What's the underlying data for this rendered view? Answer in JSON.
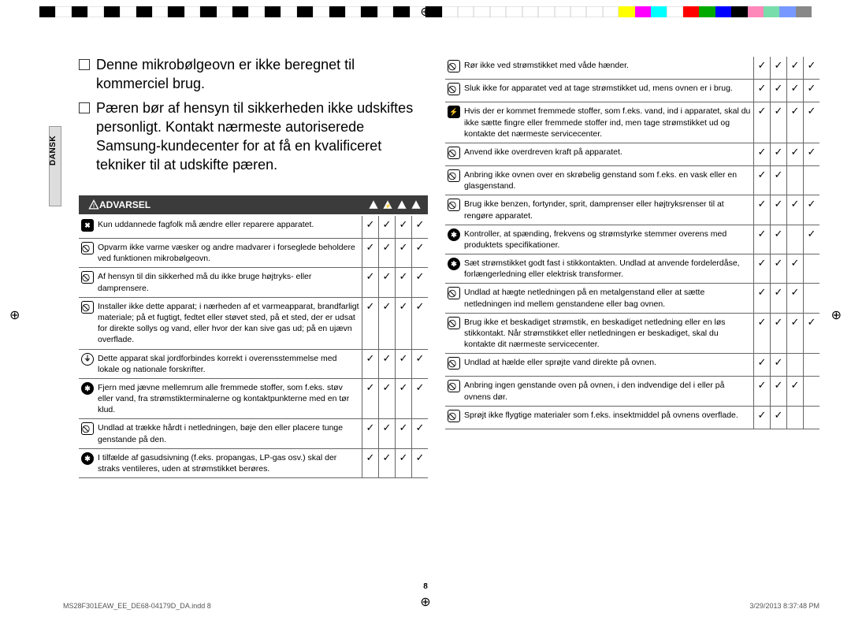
{
  "sideLabel": "DANSK",
  "intro": [
    "Denne mikrobølgeovn er ikke beregnet til kommerciel brug.",
    "Pæren bør af hensyn til sikkerheden ikke udskiftes personligt. Kontakt nærmeste autoriserede Samsung-kundecenter for at få en kvalificeret tekniker til at udskifte pæren."
  ],
  "warningLabel": "ADVARSEL",
  "left_rows": [
    {
      "icon": "tool",
      "text": "Kun uddannede fagfolk må ændre eller reparere apparatet.",
      "checks": [
        true,
        true,
        true,
        true
      ]
    },
    {
      "icon": "prohibit",
      "text": "Opvarm ikke varme væsker og andre madvarer i forseglede beholdere ved funktionen mikrobølgeovn.",
      "checks": [
        true,
        true,
        true,
        true
      ]
    },
    {
      "icon": "prohibit",
      "text": "Af hensyn til din sikkerhed må du ikke bruge højtryks- eller damprensere.",
      "checks": [
        true,
        true,
        true,
        true
      ]
    },
    {
      "icon": "prohibit",
      "text": "Installer ikke dette apparat; i nærheden af et varmeapparat, brandfarligt materiale; på et fugtigt, fedtet eller støvet sted, på et sted, der er udsat for direkte sollys og vand, eller hvor der kan sive gas ud; på en ujævn overflade.",
      "checks": [
        true,
        true,
        true,
        true
      ]
    },
    {
      "icon": "ground",
      "text": "Dette apparat skal jordforbindes korrekt i overensstemmelse med lokale og nationale forskrifter.",
      "checks": [
        true,
        true,
        true,
        true
      ]
    },
    {
      "icon": "action",
      "text": "Fjern med jævne mellemrum alle fremmede stoffer, som f.eks. støv eller vand, fra strømstikterminalerne og kontaktpunkterne med en tør klud.",
      "checks": [
        true,
        true,
        true,
        true
      ]
    },
    {
      "icon": "prohibit",
      "text": "Undlad at trække hårdt i netledningen, bøje den eller placere tunge genstande på den.",
      "checks": [
        true,
        true,
        true,
        true
      ]
    },
    {
      "icon": "action",
      "text": "I tilfælde af gasudsivning (f.eks. propangas, LP-gas osv.) skal der straks ventileres, uden at strømstikket berøres.",
      "checks": [
        true,
        true,
        true,
        true
      ]
    }
  ],
  "right_rows": [
    {
      "icon": "prohibit",
      "text": "Rør ikke ved strømstikket med våde hænder.",
      "checks": [
        true,
        true,
        true,
        true
      ]
    },
    {
      "icon": "prohibit",
      "text": "Sluk ikke for apparatet ved at tage strømstikket ud, mens ovnen er i brug.",
      "checks": [
        true,
        true,
        true,
        true
      ]
    },
    {
      "icon": "plug",
      "text": "Hvis der er kommet fremmede stoffer, som f.eks. vand, ind i apparatet, skal du ikke sætte fingre eller fremmede stoffer ind, men tage strømstikket ud og kontakte det nærmeste servicecenter.",
      "checks": [
        true,
        true,
        true,
        true
      ]
    },
    {
      "icon": "prohibit",
      "text": "Anvend ikke overdreven kraft på apparatet.",
      "checks": [
        true,
        true,
        true,
        true
      ]
    },
    {
      "icon": "prohibit",
      "text": "Anbring ikke ovnen over en skrøbelig genstand som f.eks. en vask eller en glasgenstand.",
      "checks": [
        true,
        true,
        false,
        false
      ]
    },
    {
      "icon": "prohibit",
      "text": "Brug ikke benzen, fortynder, sprit, damprenser eller højtryksrenser til at rengøre apparatet.",
      "checks": [
        true,
        true,
        true,
        true
      ]
    },
    {
      "icon": "action",
      "text": "Kontroller, at spænding, frekvens og strømstyrke stemmer overens med produktets specifikationer.",
      "checks": [
        true,
        true,
        false,
        true
      ]
    },
    {
      "icon": "action",
      "text": "Sæt strømstikket godt fast i stikkontakten. Undlad at anvende fordelerdåse, forlængerledning eller elektrisk transformer.",
      "checks": [
        true,
        true,
        true,
        false
      ]
    },
    {
      "icon": "prohibit",
      "text": "Undlad at hægte netledningen på en metalgenstand eller at sætte netledningen ind mellem genstandene eller bag ovnen.",
      "checks": [
        true,
        true,
        true,
        false
      ]
    },
    {
      "icon": "prohibit",
      "text": "Brug ikke et beskadiget strømstik, en beskadiget netledning eller en løs stikkontakt. Når strømstikket eller netledningen er beskadiget, skal du kontakte dit nærmeste servicecenter.",
      "checks": [
        true,
        true,
        true,
        true
      ]
    },
    {
      "icon": "prohibit",
      "text": "Undlad at hælde eller sprøjte vand direkte på ovnen.",
      "checks": [
        true,
        true,
        false,
        false
      ]
    },
    {
      "icon": "prohibit",
      "text": "Anbring ingen genstande oven på ovnen, i den indvendige del i eller på ovnens dør.",
      "checks": [
        true,
        true,
        true,
        false
      ]
    },
    {
      "icon": "prohibit",
      "text": "Sprøjt ikke flygtige materialer som f.eks. insektmiddel på ovnens overflade.",
      "checks": [
        true,
        true,
        false,
        false
      ]
    }
  ],
  "pageNumber": "8",
  "footer": {
    "file": "MS28F301EAW_EE_DE68-04179D_DA.indd   8",
    "datetime": "3/29/2013   8:37:48 PM"
  },
  "colorbar": [
    "#000",
    "#fff",
    "#000",
    "#fff",
    "#000",
    "#fff",
    "#000",
    "#fff",
    "#000",
    "#fff",
    "#000",
    "#fff",
    "#000",
    "#fff",
    "#000",
    "#fff",
    "#000",
    "#fff",
    "#000",
    "#fff",
    "#000",
    "#fff",
    "#000",
    "#fff",
    "#000",
    "transparent",
    "transparent",
    "transparent",
    "transparent",
    "transparent",
    "transparent",
    "transparent",
    "transparent",
    "transparent",
    "transparent",
    "transparent",
    "#ffff00",
    "#ff00ff",
    "#00ffff",
    "#fff",
    "#ff0000",
    "#00aa00",
    "#0000ff",
    "#000",
    "#ff88bb",
    "#77ddaa",
    "#7799ff",
    "#888"
  ]
}
